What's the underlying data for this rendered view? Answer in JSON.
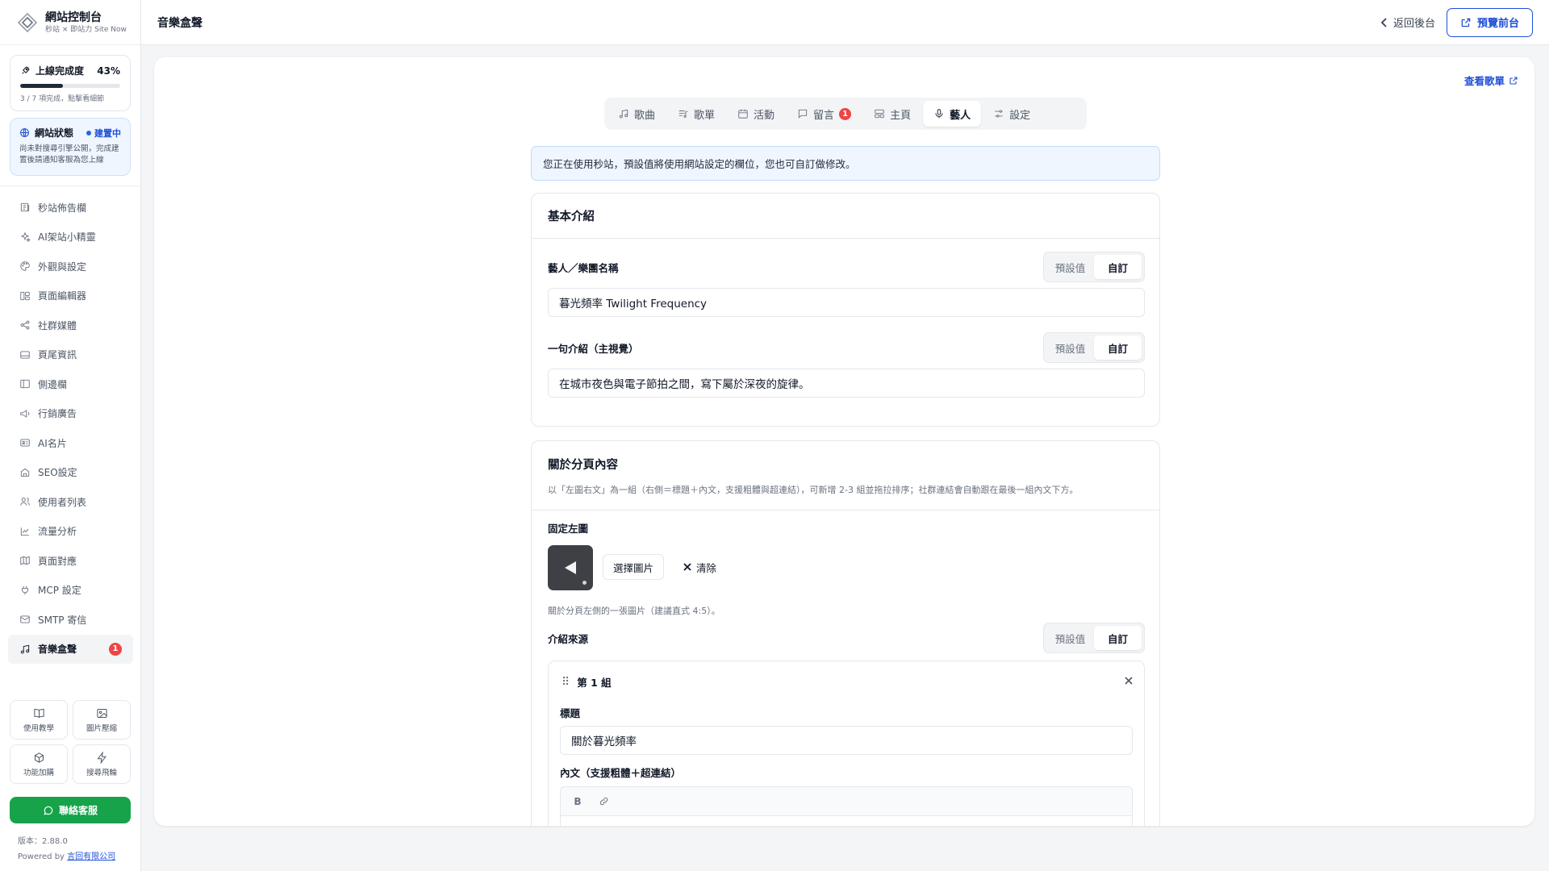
{
  "brand": {
    "title": "網站控制台",
    "subtitle": "秒站 × 即站力 Site Now"
  },
  "progress": {
    "title": "上線完成度",
    "percent_label": "43%",
    "percent": 43,
    "hint": "3 / 7 項完成，點擊看細節"
  },
  "site_status": {
    "title": "網站狀態",
    "badge": "建置中",
    "desc": "尚未對搜尋引擎公開，完成建置後請通知客服為您上線"
  },
  "nav": [
    {
      "label": "秒站佈告欄",
      "icon": "newspaper-icon"
    },
    {
      "label": "AI架站小精靈",
      "icon": "sparkles-icon"
    },
    {
      "label": "外觀與設定",
      "icon": "palette-icon"
    },
    {
      "label": "頁面編輯器",
      "icon": "layout-icon"
    },
    {
      "label": "社群媒體",
      "icon": "share-icon"
    },
    {
      "label": "頁尾資訊",
      "icon": "footer-icon"
    },
    {
      "label": "側邊欄",
      "icon": "sidebar-icon"
    },
    {
      "label": "行銷廣告",
      "icon": "megaphone-icon"
    },
    {
      "label": "AI名片",
      "icon": "id-card-icon"
    },
    {
      "label": "SEO設定",
      "icon": "seo-icon"
    },
    {
      "label": "使用者列表",
      "icon": "users-icon"
    },
    {
      "label": "流量分析",
      "icon": "chart-icon"
    },
    {
      "label": "頁面對應",
      "icon": "map-icon"
    },
    {
      "label": "MCP 設定",
      "icon": "plug-icon"
    },
    {
      "label": "SMTP 寄信",
      "icon": "mail-icon"
    },
    {
      "label": "音樂盒聲",
      "icon": "music-icon",
      "badge": "1",
      "active": true
    }
  ],
  "tiles": [
    {
      "label": "使用教學",
      "icon": "book-icon"
    },
    {
      "label": "圖片壓縮",
      "icon": "image-icon"
    },
    {
      "label": "功能加購",
      "icon": "package-icon"
    },
    {
      "label": "搜尋飛輪",
      "icon": "bolt-icon"
    }
  ],
  "contact_button": "聯絡客服",
  "version": {
    "label": "版本：2.88.0",
    "powered_by": "Powered by",
    "company": "言回有限公司"
  },
  "topbar": {
    "title": "音樂盒聲",
    "back": "返回後台",
    "preview": "預覽前台"
  },
  "view_list": "查看歌單",
  "tabs": [
    {
      "label": "歌曲",
      "icon": "music-note-icon"
    },
    {
      "label": "歌單",
      "icon": "playlist-icon"
    },
    {
      "label": "活動",
      "icon": "calendar-icon"
    },
    {
      "label": "留言",
      "icon": "message-icon",
      "badge": "1"
    },
    {
      "label": "主頁",
      "icon": "home-layout-icon"
    },
    {
      "label": "藝人",
      "icon": "mic-icon",
      "active": true
    },
    {
      "label": "設定",
      "icon": "sliders-icon"
    }
  ],
  "notice": "您正在使用秒站，預設值將使用網站設定的欄位，您也可自訂做修改。",
  "segment": {
    "default": "預設值",
    "custom": "自訂"
  },
  "basic": {
    "title": "基本介紹",
    "name_label": "藝人／樂團名稱",
    "name_value": "暮光頻率 Twilight Frequency",
    "tagline_label": "一句介紹（主視覺）",
    "tagline_value": "在城市夜色與電子節拍之間，寫下屬於深夜的旋律。"
  },
  "about": {
    "title": "關於分頁內容",
    "desc": "以「左圖右文」為一組（右側＝標題＋內文，支援粗體與超連結），可新增 2-3 組並拖拉排序；社群連結會自動跟在最後一組內文下方。",
    "fixed_image_label": "固定左圖",
    "choose_image": "選擇圖片",
    "clear": "清除",
    "image_hint": "關於分頁左側的一張圖片（建議直式 4:5）。",
    "source_label": "介紹來源",
    "group": {
      "title": "第 1 組",
      "heading_label": "標題",
      "heading_value": "關於暮光頻率",
      "body_label": "內文（支援粗體＋超連結）",
      "bold_tool": "B"
    }
  }
}
